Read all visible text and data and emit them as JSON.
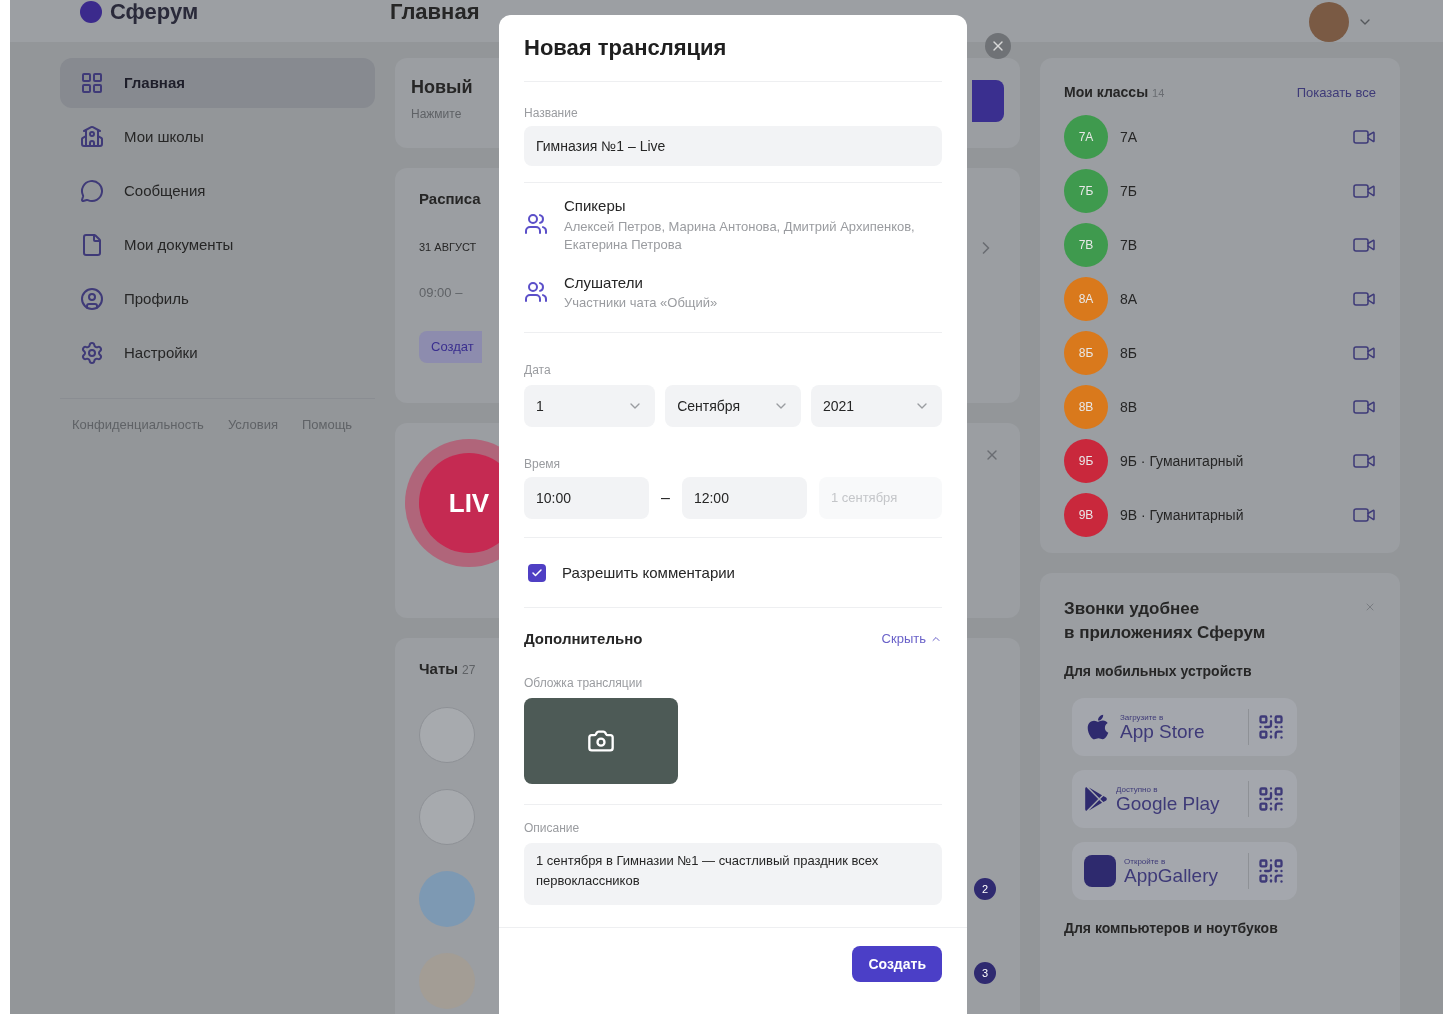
{
  "header": {
    "logo": "Сферум",
    "page_title": "Главная"
  },
  "sidebar": {
    "items": [
      {
        "kind": "grid",
        "label": "Главная",
        "selected": true
      },
      {
        "kind": "school",
        "label": "Мои школы",
        "selected": false
      },
      {
        "kind": "messages",
        "label": "Сообщения",
        "selected": false
      },
      {
        "kind": "documents",
        "label": "Мои документы",
        "selected": false
      },
      {
        "kind": "profile",
        "label": "Профиль",
        "selected": false
      },
      {
        "kind": "settings",
        "label": "Настройки",
        "selected": false
      }
    ],
    "footer_links": [
      "Конфиденциальность",
      "Условия",
      "Помощь"
    ]
  },
  "feed": {
    "new_card": {
      "title": "Новый",
      "subtitle": "Нажмите"
    },
    "schedule_card": {
      "title": "Расписа",
      "date": "31 АВГУСТ",
      "time": "09:00 –",
      "button": "Создат"
    },
    "live_card": {
      "badge": "LIV"
    },
    "chats_card": {
      "title": "Чаты",
      "count": "27",
      "badges": [
        "2",
        "3"
      ]
    }
  },
  "classes": {
    "title": "Мои классы",
    "count": "14",
    "show_all": "Показать все",
    "items": [
      {
        "initials": "7А",
        "name": "7А",
        "color": "#3f9a4e"
      },
      {
        "initials": "7Б",
        "name": "7Б",
        "color": "#3f9a4e"
      },
      {
        "initials": "7В",
        "name": "7В",
        "color": "#3f9a4e"
      },
      {
        "initials": "8А",
        "name": "8А",
        "color": "#d9791c"
      },
      {
        "initials": "8Б",
        "name": "8Б",
        "color": "#d9791c"
      },
      {
        "initials": "8В",
        "name": "8В",
        "color": "#d9791c"
      },
      {
        "initials": "9Б",
        "name": "9Б · Гуманитарный",
        "color": "#c9283c"
      },
      {
        "initials": "9В",
        "name": "9В · Гуманитарный",
        "color": "#c9283c"
      }
    ]
  },
  "apps_card": {
    "title_lines": [
      "Звонки удобнее",
      "в приложениях Сферум"
    ],
    "subtitle": "Для мобильных устройств",
    "stores": [
      {
        "kind": "apple",
        "caption": "Загрузите в",
        "name": "App Store"
      },
      {
        "kind": "google",
        "caption": "Доступно в",
        "name": "Google Play"
      },
      {
        "kind": "huawei",
        "caption": "Откройте в",
        "name": "AppGallery"
      }
    ],
    "desktop_heading": "Для компьютеров и ноутбуков"
  },
  "modal": {
    "title": "Новая трансляция",
    "name_label": "Название",
    "name_value": "Гимназия №1 – Live",
    "people": [
      {
        "title": "Спикеры",
        "value": "Алексей Петров, Марина Антонова, Дмитрий Архипенков, Екатерина Петрова"
      },
      {
        "title": "Слушатели",
        "value": "Участники чата «Общий»"
      }
    ],
    "date_label": "Дата",
    "date": [
      "1",
      "Сентября",
      "2021"
    ],
    "time_label": "Время",
    "time_start": "10:00",
    "time_separator": "–",
    "time_end": "12:00",
    "end_date": "1 сентября",
    "comments": {
      "label": "Разрешить комментарии",
      "checked": true
    },
    "extra_title": "Дополнительно",
    "extra_toggle": "Скрыть",
    "extra_expanded": true,
    "cover_label": "Обложка трансляции",
    "description_label": "Описание",
    "description": "1 сентября в Гимназии №1 — счастливый праздник всех первоклассников",
    "submit": "Создать"
  }
}
